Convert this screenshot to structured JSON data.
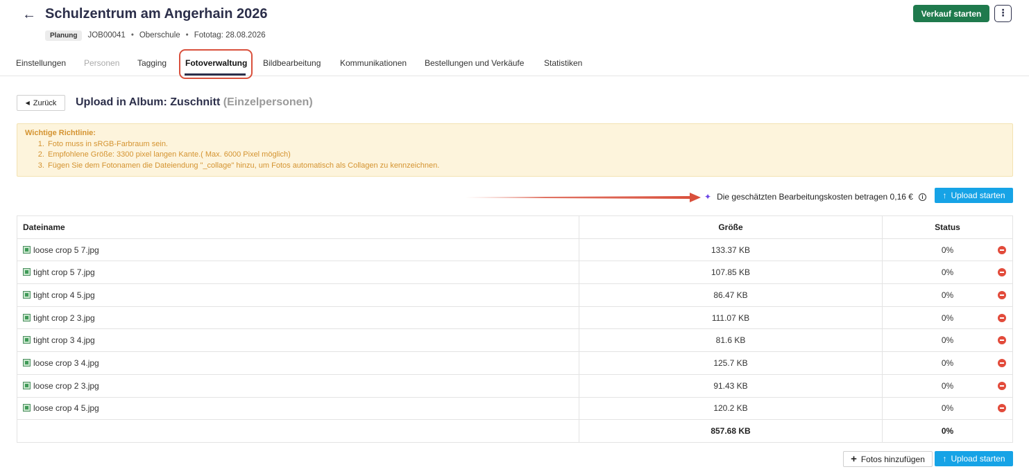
{
  "header": {
    "title": "Schulzentrum am Angerhain 2026",
    "badge": "Planung",
    "job_id": "JOB00041",
    "school_type": "Oberschule",
    "photo_day": "Fototag: 28.08.2026",
    "sale_button": "Verkauf starten",
    "more_icon": "kebab-icon"
  },
  "tabs": [
    {
      "label": "Einstellungen",
      "state": "normal"
    },
    {
      "label": "Personen",
      "state": "disabled"
    },
    {
      "label": "Tagging",
      "state": "normal"
    },
    {
      "label": "Fotoverwaltung",
      "state": "active"
    },
    {
      "label": "Bildbearbeitung",
      "state": "normal"
    },
    {
      "label": "Kommunikationen",
      "state": "normal"
    },
    {
      "label": "Bestellungen und Verkäufe",
      "state": "normal"
    },
    {
      "label": "Statistiken",
      "state": "normal"
    }
  ],
  "upload": {
    "back_label": "Zurück",
    "title_main": "Upload in Album: Zuschnitt",
    "title_sub": "(Einzelpersonen)"
  },
  "notice": {
    "title": "Wichtige Richtlinie:",
    "items": [
      "Foto muss in sRGB-Farbraum sein.",
      "Empfohlene Größe: 3300 pixel langen Kante.( Max. 6000 Pixel möglich)",
      "Fügen Sie dem Fotonamen die Dateiendung \"_collage\" hinzu, um Fotos automatisch als Collagen zu kennzeichnen."
    ]
  },
  "cost": {
    "text": "Die geschätzten Bearbeitungskosten betragen 0,16 €",
    "upload_button": "Upload starten"
  },
  "table": {
    "headers": [
      "Dateiname",
      "Größe",
      "Status"
    ],
    "rows": [
      {
        "name": "loose crop 5 7.jpg",
        "size": "133.37 KB",
        "status": "0%"
      },
      {
        "name": "tight crop 5 7.jpg",
        "size": "107.85 KB",
        "status": "0%"
      },
      {
        "name": "tight crop 4 5.jpg",
        "size": "86.47 KB",
        "status": "0%"
      },
      {
        "name": "tight crop 2 3.jpg",
        "size": "111.07 KB",
        "status": "0%"
      },
      {
        "name": "tight crop 3 4.jpg",
        "size": "81.6 KB",
        "status": "0%"
      },
      {
        "name": "loose crop 3 4.jpg",
        "size": "125.7 KB",
        "status": "0%"
      },
      {
        "name": "loose crop 2 3.jpg",
        "size": "91.43 KB",
        "status": "0%"
      },
      {
        "name": "loose crop 4 5.jpg",
        "size": "120.2 KB",
        "status": "0%"
      }
    ],
    "total_size": "857.68 KB",
    "total_status": "0%"
  },
  "footer": {
    "add_button": "Fotos hinzufügen",
    "upload_button": "Upload starten"
  },
  "colors": {
    "primary_green": "#1f7a4d",
    "upload_blue": "#16a3e6",
    "annotation_red": "#d9503c",
    "notice_text": "#d49330"
  }
}
